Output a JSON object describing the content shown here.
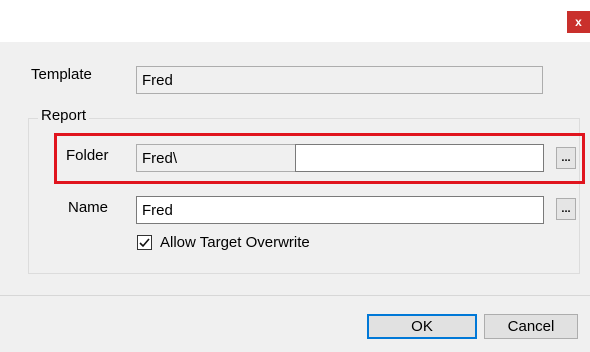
{
  "window": {
    "close_label": "x"
  },
  "template": {
    "label": "Template",
    "value": "Fred"
  },
  "report": {
    "group_label": "Report",
    "folder": {
      "label": "Folder",
      "base_value": "Fred\\",
      "value": "",
      "browse_label": "..."
    },
    "name": {
      "label": "Name",
      "value": "Fred",
      "browse_label": "..."
    },
    "allow_overwrite": {
      "label": "Allow Target Overwrite",
      "checked": true
    }
  },
  "buttons": {
    "ok": "OK",
    "cancel": "Cancel"
  },
  "colors": {
    "close_bg": "#c9302c",
    "highlight": "#e0141e",
    "default_button_border": "#0078d7"
  }
}
